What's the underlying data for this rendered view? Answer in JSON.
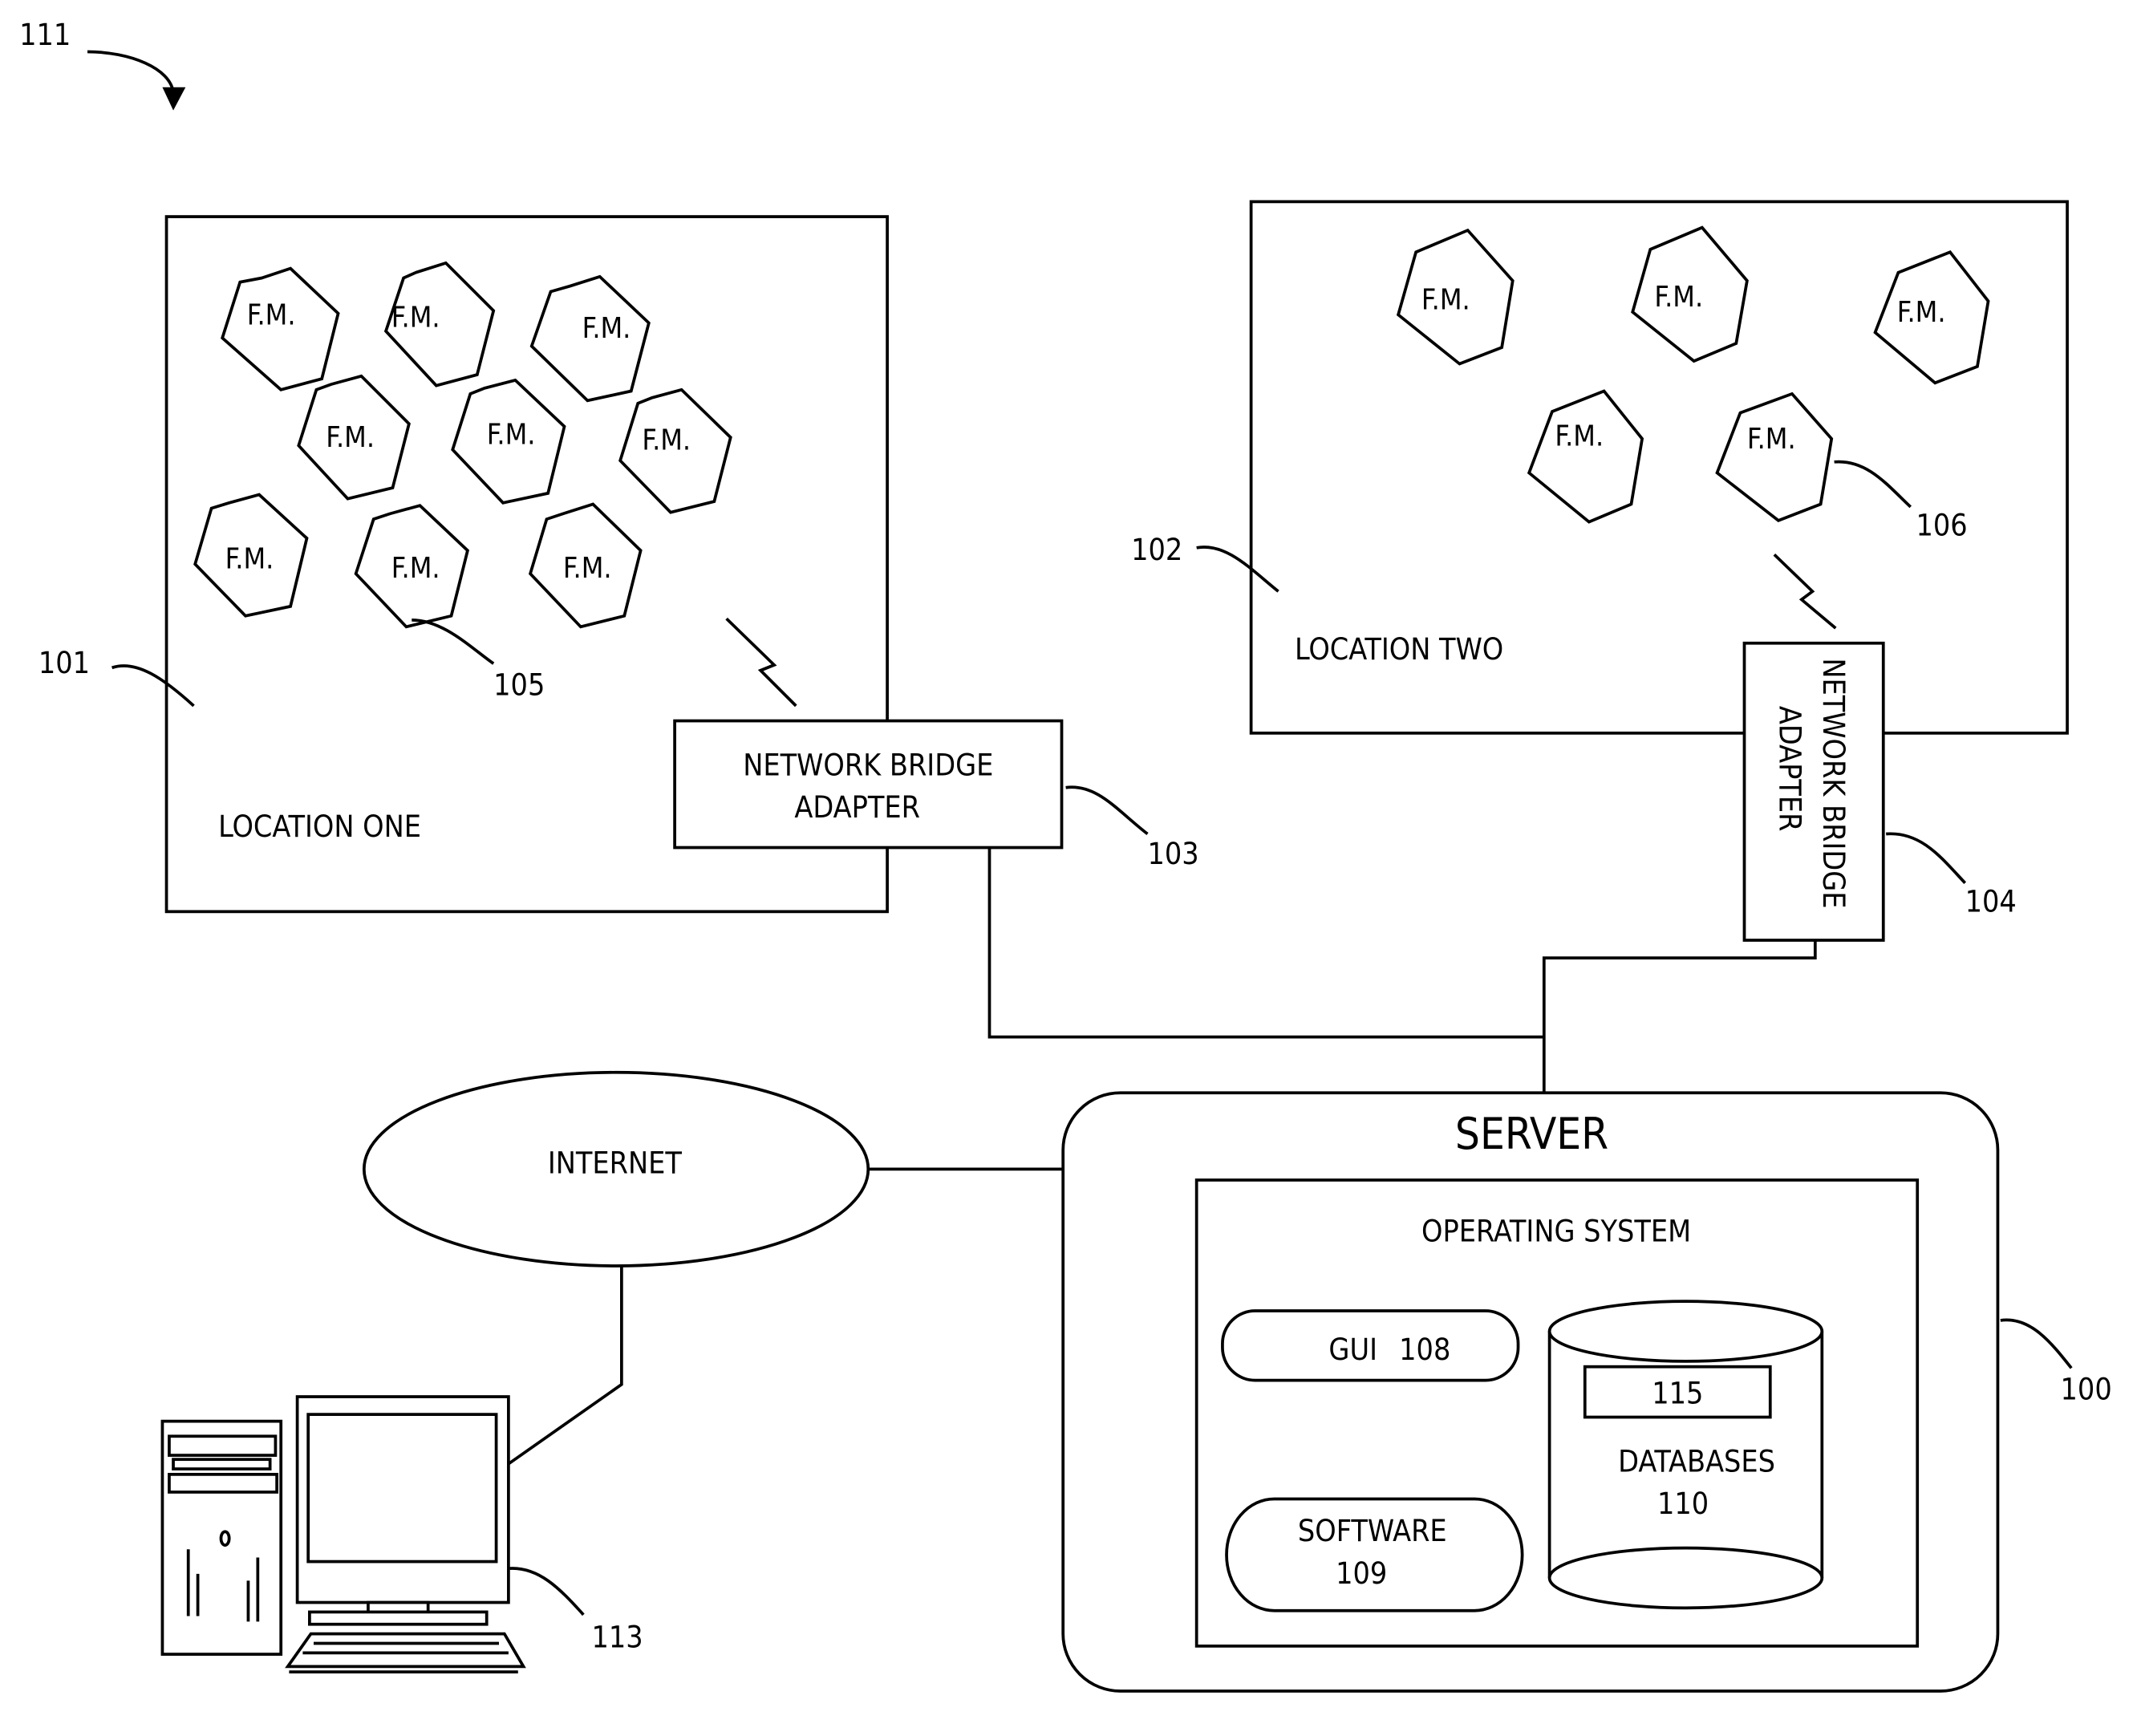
{
  "figure_ref": "111",
  "locations": [
    {
      "ref": "101",
      "label": "LOCATION ONE",
      "device_label": "F.M.",
      "device_ref": "105",
      "device_count": 9
    },
    {
      "ref": "102",
      "label": "LOCATION TWO",
      "device_label": "F.M.",
      "device_ref": "106",
      "device_count": 5
    }
  ],
  "bridges": [
    {
      "ref": "103",
      "line1": "NETWORK BRIDGE",
      "line2": "ADAPTER"
    },
    {
      "ref": "104",
      "line1": "NETWORK BRIDGE",
      "line2": "ADAPTER"
    }
  ],
  "internet": {
    "label": "INTERNET"
  },
  "server": {
    "ref": "100",
    "title": "SERVER",
    "os_label": "OPERATING SYSTEM",
    "gui_label": "GUI",
    "gui_ref": "108",
    "software_label": "SOFTWARE",
    "software_ref": "109",
    "db_label": "DATABASES",
    "db_ref": "110",
    "db_inner_ref": "115"
  },
  "computer": {
    "ref": "113"
  }
}
